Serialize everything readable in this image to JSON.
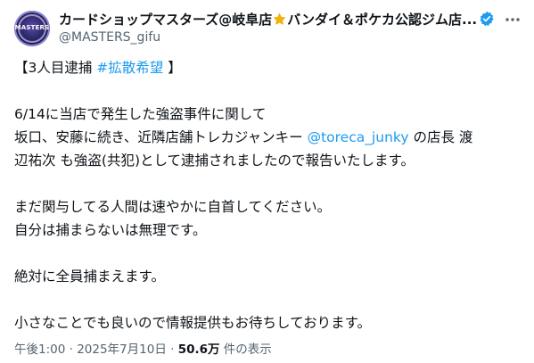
{
  "author": {
    "avatar_text": "MASTERS",
    "name_part1": "カードショップマスターズ@岐阜店",
    "name_part2": "バンダイ＆ポケカ公認ジム店...",
    "handle": "@MASTERS_gifu"
  },
  "post": {
    "line1_prefix": "【3人目逮捕 ",
    "line1_hashtag": "#拡散希望",
    "line1_suffix": " 】",
    "line2": "6/14に当店で発生した強盗事件に関して",
    "line3_prefix": "坂口、安藤に続き、近隣店舗トレカジャンキー ",
    "line3_mention": "@toreca_junky",
    "line3_suffix": " の店長 渡",
    "line4": "辺祐次 も強盗(共犯)として逮捕されましたので報告いたします。",
    "line5": "まだ関与してる人間は速やかに自首してください。",
    "line6": "自分は捕まらないは無理です。",
    "line7": "絶対に全員捕まえます。",
    "line8": "小さなことでも良いので情報提供もお待ちしております。"
  },
  "meta": {
    "time": "午後1:00",
    "separator": " · ",
    "date": "2025年7月10日",
    "views": "50.6万",
    "views_label": " 件の表示"
  },
  "colors": {
    "link": "#1d9bf0",
    "verified": "#1d9bf0",
    "secondary_text": "#536471",
    "star": "#f5b400"
  },
  "icons": [
    "star-icon",
    "verified-badge-icon",
    "more-options-icon"
  ]
}
